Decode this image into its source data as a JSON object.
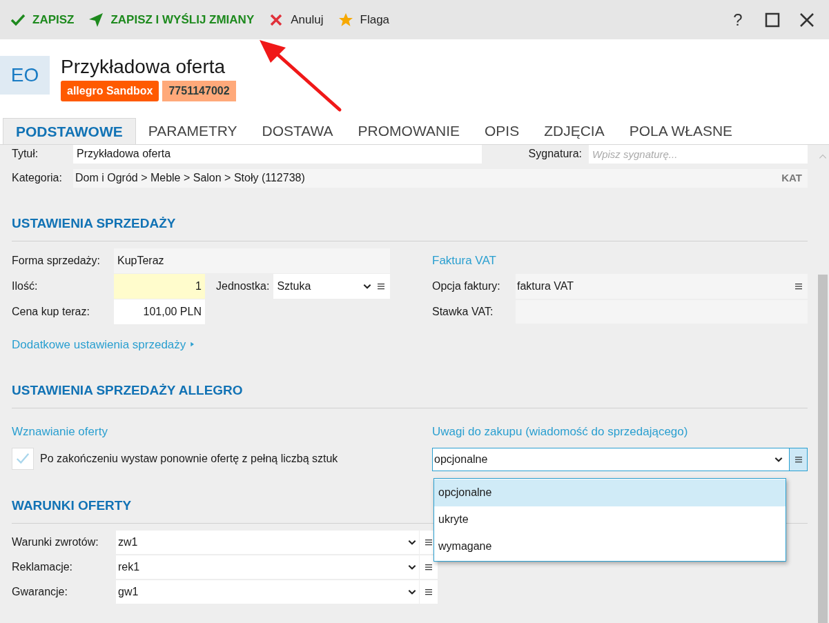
{
  "toolbar": {
    "actions": [
      {
        "label": "ZAPISZ",
        "kind": "check"
      },
      {
        "label": "ZAPISZ I WYŚLIJ ZMIANY",
        "kind": "send"
      },
      {
        "label": "Anuluj",
        "kind": "cancel"
      },
      {
        "label": "Flaga",
        "kind": "star"
      }
    ],
    "help": "?"
  },
  "header": {
    "avatar": "EO",
    "title": "Przykładowa oferta",
    "badges": [
      {
        "label": "allegro Sandbox",
        "kind": "platform"
      },
      {
        "label": "7751147002",
        "kind": "id"
      }
    ]
  },
  "tabs": [
    {
      "label": "PODSTAWOWE",
      "selected": true
    },
    {
      "label": "PARAMETRY",
      "selected": false
    },
    {
      "label": "DOSTAWA",
      "selected": false
    },
    {
      "label": "PROMOWANIE",
      "selected": false
    },
    {
      "label": "OPIS",
      "selected": false
    },
    {
      "label": "ZDJĘCIA",
      "selected": false
    },
    {
      "label": "POLA WŁASNE",
      "selected": false
    }
  ],
  "title_field": {
    "label": "Tytuł:",
    "value": "Przykładowa oferta"
  },
  "signature_field": {
    "label": "Sygnatura:",
    "placeholder": "Wpisz sygnaturę..."
  },
  "category_field": {
    "label": "Kategoria:",
    "value": "Dom i Ogród > Meble > Salon > Stoły (112738)",
    "button": "KAT"
  },
  "sales": {
    "heading": "USTAWIENIA SPRZEDAŻY",
    "form": {
      "label": "Forma sprzedaży:",
      "value": "KupTeraz"
    },
    "quantity": {
      "label": "Ilość:",
      "value": "1"
    },
    "unit": {
      "label": "Jednostka:",
      "value": "Sztuka"
    },
    "price": {
      "label": "Cena kup teraz:",
      "value": "101,00 PLN"
    },
    "more_link": "Dodatkowe ustawienia sprzedaży",
    "invoice": {
      "heading": "Faktura VAT",
      "option": {
        "label": "Opcja faktury:",
        "value": "faktura VAT"
      },
      "rate": {
        "label": "Stawka VAT:"
      }
    }
  },
  "allegro": {
    "heading": "USTAWIENIA SPRZEDAŻY ALLEGRO",
    "renewal": {
      "heading": "Wznawianie oferty",
      "checkbox": {
        "label": "Po zakończeniu wystaw ponownie ofertę z pełną liczbą sztuk",
        "checked": true
      }
    },
    "remarks": {
      "heading": "Uwagi do zakupu (wiadomość do sprzedającego)",
      "value": "opcjonalne",
      "expanded": true,
      "options": [
        {
          "label": "opcjonalne",
          "selected": true
        },
        {
          "label": "ukryte",
          "selected": false
        },
        {
          "label": "wymagane",
          "selected": false
        }
      ]
    }
  },
  "terms": {
    "heading": "WARUNKI OFERTY",
    "rows": [
      {
        "label": "Warunki zwrotów:",
        "value": "zw1"
      },
      {
        "label": "Reklamacje:",
        "value": "rek1"
      },
      {
        "label": "Gwarancje:",
        "value": "gw1"
      }
    ]
  }
}
